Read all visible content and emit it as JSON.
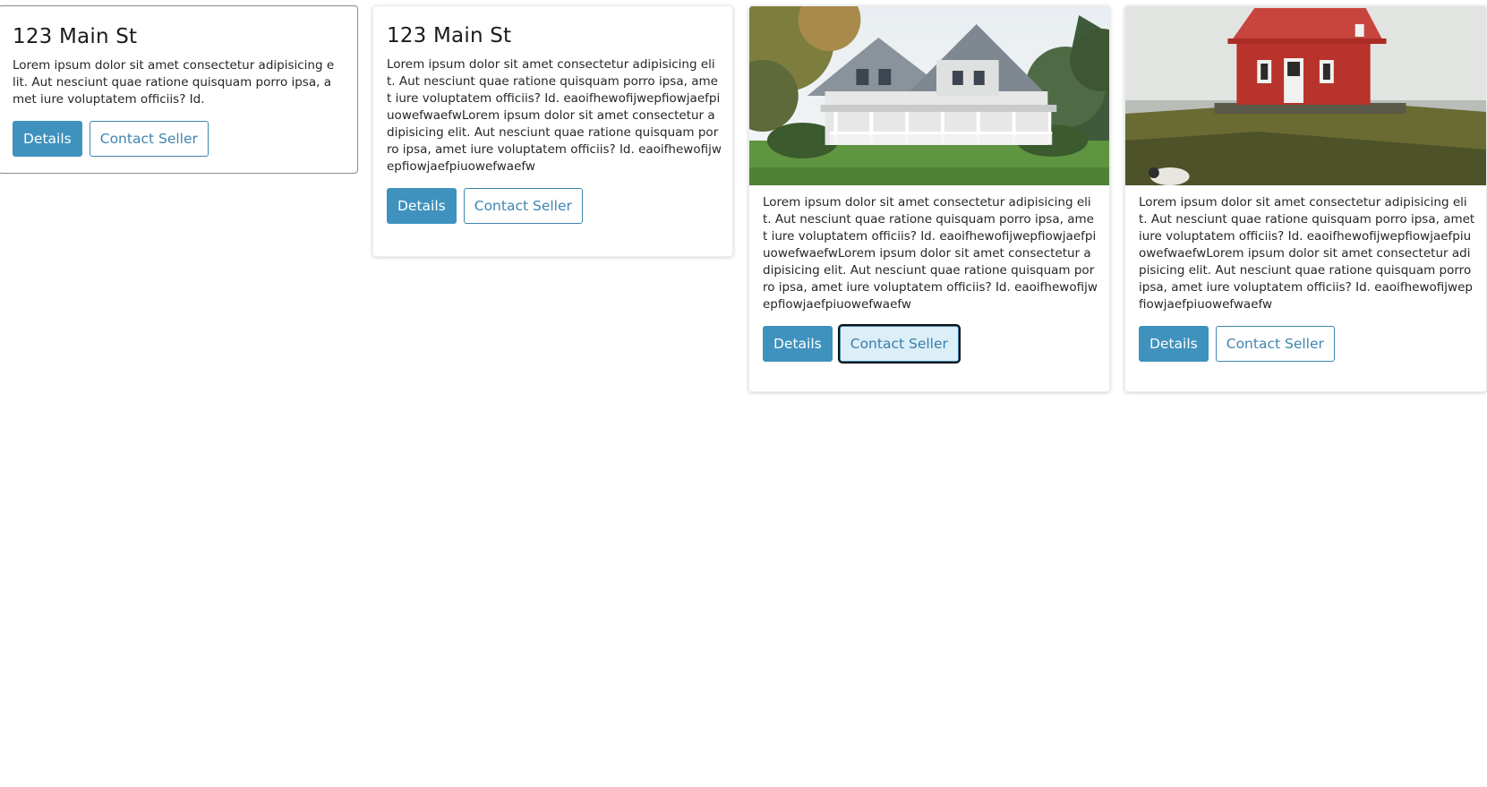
{
  "cards": [
    {
      "title": "123 Main St",
      "text": "Lorem ipsum dolor sit amet consectetur adipisicing elit. Aut nesciunt quae ratione quisquam porro ipsa, amet iure voluptatem officiis? Id.",
      "details_label": "Details",
      "contact_label": "Contact Seller"
    },
    {
      "title": "123 Main St",
      "text": "Lorem ipsum dolor sit amet consectetur adipisicing elit. Aut nesciunt quae ratione quisquam porro ipsa, amet iure voluptatem officiis? Id. eaoifhewofijwepfiowjaefpiuowefwaefwLorem ipsum dolor sit amet consectetur adipisicing elit. Aut nesciunt quae ratione quisquam porro ipsa, amet iure voluptatem officiis? Id. eaoifhewofijwepfiowjaefpiuowefwaefw",
      "details_label": "Details",
      "contact_label": "Contact Seller"
    },
    {
      "image": "white-house-photo",
      "text": "Lorem ipsum dolor sit amet consectetur adipisicing elit. Aut nesciunt quae ratione quisquam porro ipsa, amet iure voluptatem officiis? Id. eaoifhewofijwepfiowjaefpiuowefwaefwLorem ipsum dolor sit amet consectetur adipisicing elit. Aut nesciunt quae ratione quisquam porro ipsa, amet iure voluptatem officiis? Id. eaoifhewofijwepfiowjaefpiuowefwaefw",
      "details_label": "Details",
      "contact_label": "Contact Seller"
    },
    {
      "image": "red-cabin-photo",
      "text": "Lorem ipsum dolor sit amet consectetur adipisicing elit. Aut nesciunt quae ratione quisquam porro ipsa, amet iure voluptatem officiis? Id. eaoifhewofijwepfiowjaefpiuowefwaefwLorem ipsum dolor sit amet consectetur adipisicing elit. Aut nesciunt quae ratione quisquam porro ipsa, amet iure voluptatem officiis? Id. eaoifhewofijwepfiowjaefpiuowefwaefw",
      "details_label": "Details",
      "contact_label": "Contact Seller"
    }
  ],
  "colors": {
    "primary": "#3f92bd",
    "outline": "#3f85b0",
    "focus_fill": "#dceef8"
  }
}
